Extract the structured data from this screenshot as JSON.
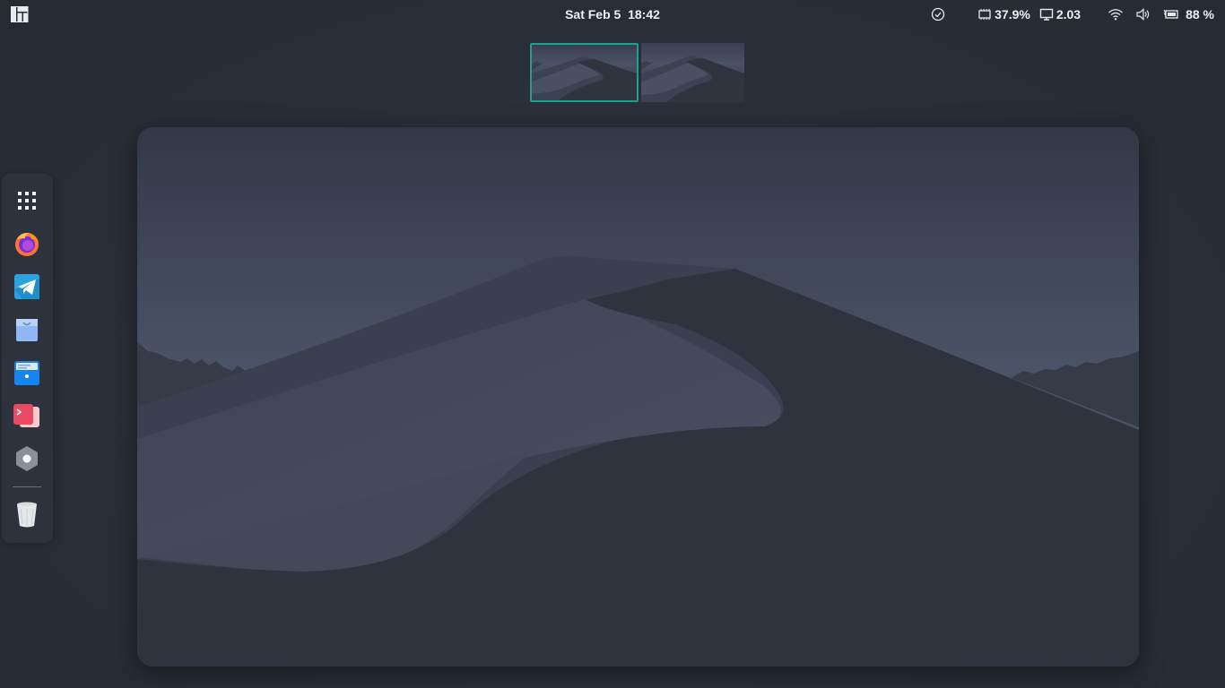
{
  "topbar": {
    "date": "Sat Feb 5",
    "time": "18:42",
    "tray": {
      "cpu_value": "37.9%",
      "load_value": "2.03",
      "battery_value": "88 %"
    }
  },
  "workspaces": [
    {
      "name": "workspace-1",
      "active": true
    },
    {
      "name": "workspace-2",
      "active": false
    }
  ],
  "dock": {
    "items": [
      {
        "name": "show-apps",
        "icon": "app-grid-icon"
      },
      {
        "name": "firefox",
        "icon": "firefox-icon"
      },
      {
        "name": "telegram",
        "icon": "telegram-icon"
      },
      {
        "name": "software-store",
        "icon": "shopping-bag-icon"
      },
      {
        "name": "files",
        "icon": "file-manager-icon"
      },
      {
        "name": "terminal",
        "icon": "terminal-icon"
      },
      {
        "name": "settings",
        "icon": "gear-icon"
      },
      {
        "name": "trash",
        "icon": "trash-icon"
      }
    ]
  },
  "colors": {
    "accent": "#1fa08a",
    "background": "#2b2f3a",
    "dock": "#2e323d",
    "sky_top": "#333846",
    "sky_bottom": "#4b5368",
    "dune_dark": "#2f333f",
    "dune_light": "#454b5d"
  }
}
